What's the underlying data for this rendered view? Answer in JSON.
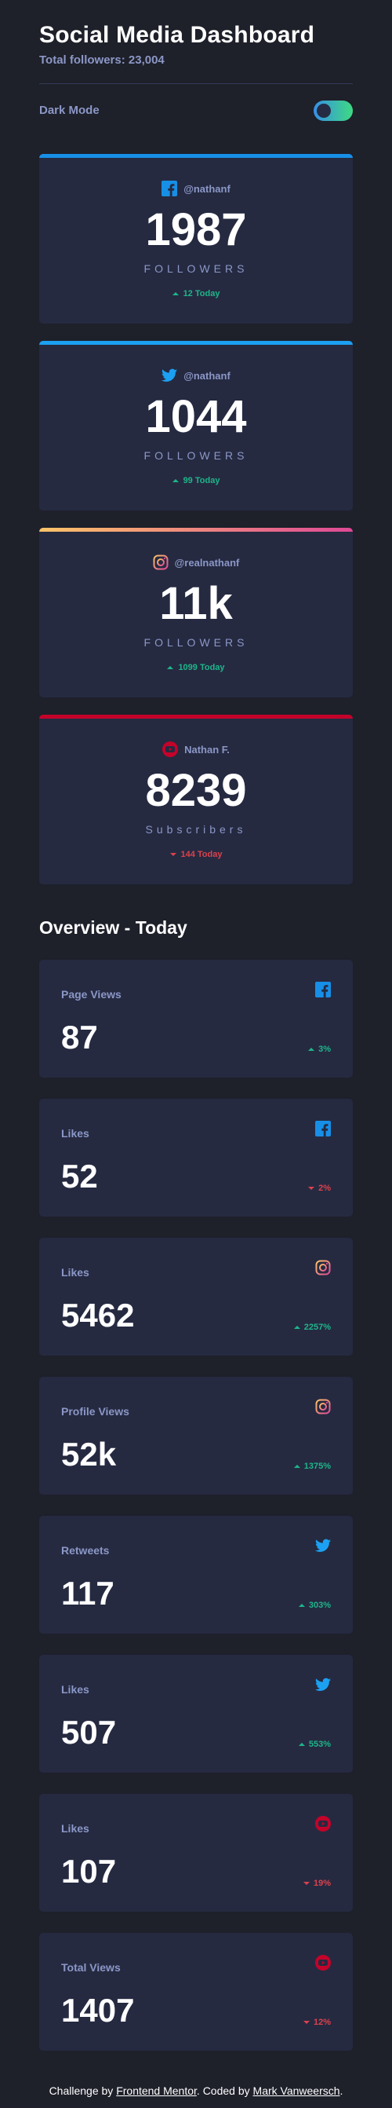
{
  "header": {
    "title": "Social Media Dashboard",
    "subtitle": "Total followers: 23,004",
    "dark_mode_label": "Dark Mode",
    "dark_mode_on": true
  },
  "colors": {
    "facebook": "#178fe6",
    "twitter": "#1ca0f2",
    "instagram_start": "#fdc468",
    "instagram_end": "#df4996",
    "youtube": "#c4032a",
    "up": "#1eb589",
    "down": "#dc414c"
  },
  "cards": [
    {
      "platform": "facebook",
      "icon": "facebook-icon",
      "handle": "@nathanf",
      "count": "1987",
      "unit": "FOLLOWERS",
      "change": "12 Today",
      "direction": "up"
    },
    {
      "platform": "twitter",
      "icon": "twitter-icon",
      "handle": "@nathanf",
      "count": "1044",
      "unit": "FOLLOWERS",
      "change": "99 Today",
      "direction": "up"
    },
    {
      "platform": "instagram",
      "icon": "instagram-icon",
      "handle": "@realnathanf",
      "count": "11k",
      "unit": "FOLLOWERS",
      "change": "1099 Today",
      "direction": "up"
    },
    {
      "platform": "youtube",
      "icon": "youtube-icon",
      "handle": "Nathan F.",
      "count": "8239",
      "unit": "Subscribers",
      "change": "144 Today",
      "direction": "down"
    }
  ],
  "overview": {
    "title": "Overview - Today",
    "items": [
      {
        "label": "Page Views",
        "platform": "facebook",
        "icon": "facebook-icon",
        "value": "87",
        "change": "3%",
        "direction": "up"
      },
      {
        "label": "Likes",
        "platform": "facebook",
        "icon": "facebook-icon",
        "value": "52",
        "change": "2%",
        "direction": "down"
      },
      {
        "label": "Likes",
        "platform": "instagram",
        "icon": "instagram-icon",
        "value": "5462",
        "change": "2257%",
        "direction": "up"
      },
      {
        "label": "Profile Views",
        "platform": "instagram",
        "icon": "instagram-icon",
        "value": "52k",
        "change": "1375%",
        "direction": "up"
      },
      {
        "label": "Retweets",
        "platform": "twitter",
        "icon": "twitter-icon",
        "value": "117",
        "change": "303%",
        "direction": "up"
      },
      {
        "label": "Likes",
        "platform": "twitter",
        "icon": "twitter-icon",
        "value": "507",
        "change": "553%",
        "direction": "up"
      },
      {
        "label": "Likes",
        "platform": "youtube",
        "icon": "youtube-icon",
        "value": "107",
        "change": "19%",
        "direction": "down"
      },
      {
        "label": "Total Views",
        "platform": "youtube",
        "icon": "youtube-icon",
        "value": "1407",
        "change": "12%",
        "direction": "down"
      }
    ]
  },
  "footer": {
    "prefix": "Challenge by ",
    "link1": "Frontend Mentor",
    "middle": ". Coded by ",
    "link2": "Mark Vanweersch",
    "suffix": "."
  }
}
